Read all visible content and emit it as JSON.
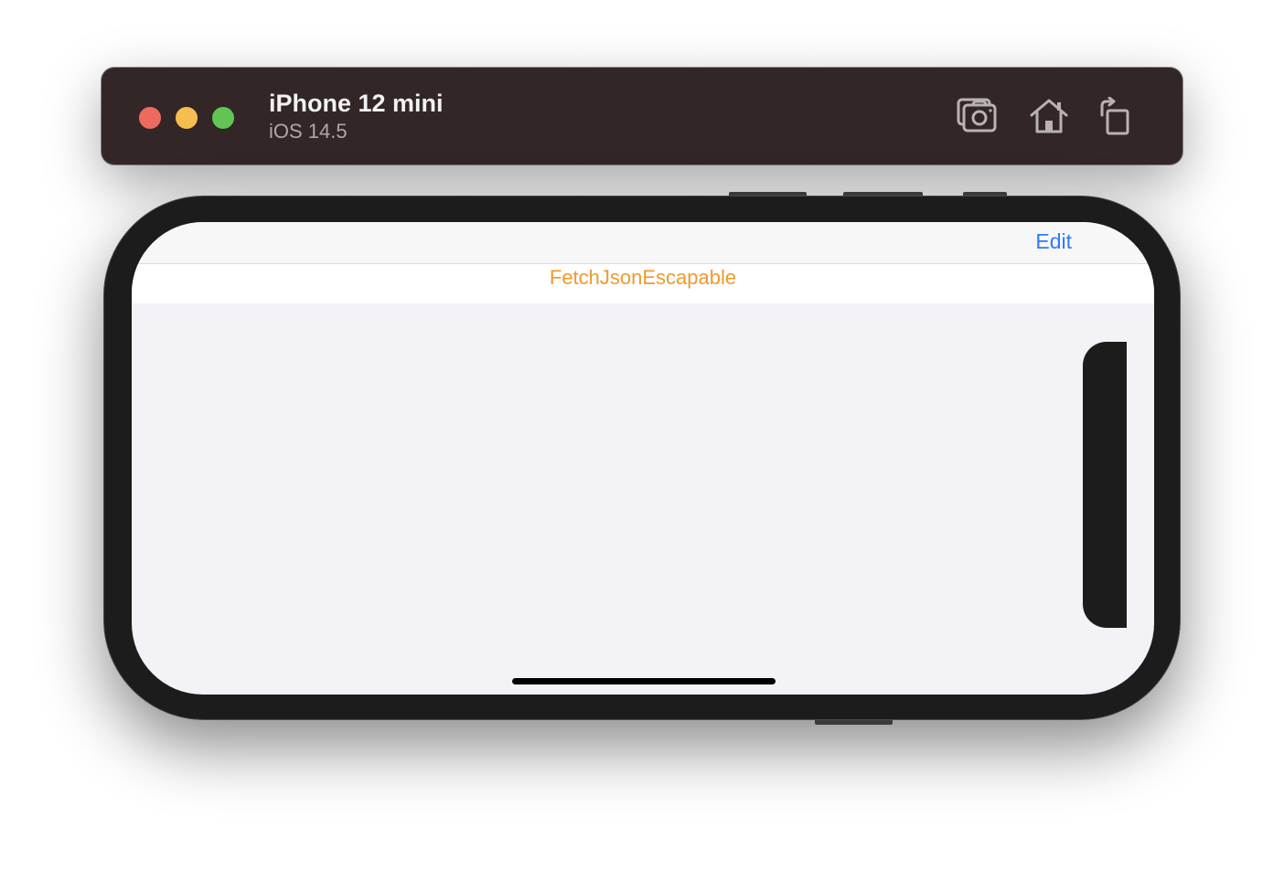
{
  "window": {
    "device_name": "iPhone 12 mini",
    "os_version": "iOS 14.5",
    "toolbar": {
      "screenshot_icon": "camera-icon",
      "home_icon": "home-icon",
      "rotate_icon": "rotate-icon"
    }
  },
  "app": {
    "navbar": {
      "edit_label": "Edit"
    },
    "title": "FetchJsonEscapable"
  },
  "colors": {
    "titlebar": "#322626",
    "close": "#ee6a5f",
    "minimize": "#f5be4f",
    "zoom": "#61c554",
    "accent_blue": "#2f7cf6",
    "title_orange": "#f0992d",
    "screen_background": "#f2f2f7",
    "device_frame": "#1c1c1c"
  }
}
